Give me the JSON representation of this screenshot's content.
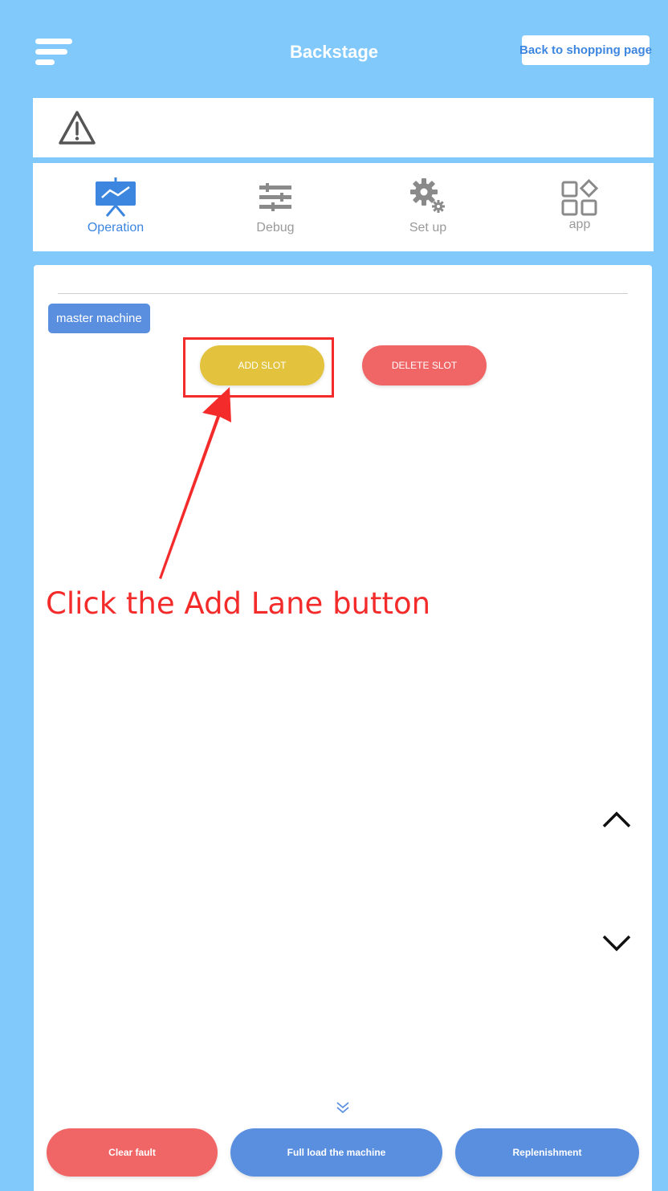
{
  "header": {
    "title": "Backstage",
    "back_button": "Back to shopping page"
  },
  "tabs": [
    {
      "label": "Operation",
      "icon": "presentation-chart-icon",
      "active": true
    },
    {
      "label": "Debug",
      "icon": "sliders-icon",
      "active": false
    },
    {
      "label": "Set up",
      "icon": "gears-icon",
      "active": false
    },
    {
      "label": "app",
      "icon": "apps-grid-icon",
      "active": false
    }
  ],
  "machine_tag": "master machine",
  "slot_buttons": {
    "add": "ADD SLOT",
    "delete": "DELETE SLOT"
  },
  "annotation": "Click the Add Lane button",
  "footer": {
    "clear_fault": "Clear fault",
    "full_load": "Full load the machine",
    "replenishment": "Replenishment"
  },
  "colors": {
    "background": "#82c9fb",
    "accent_blue": "#5a8fe0",
    "add_yellow": "#e3c33d",
    "danger_red": "#f06565",
    "annotation_red": "#f42b2b"
  }
}
